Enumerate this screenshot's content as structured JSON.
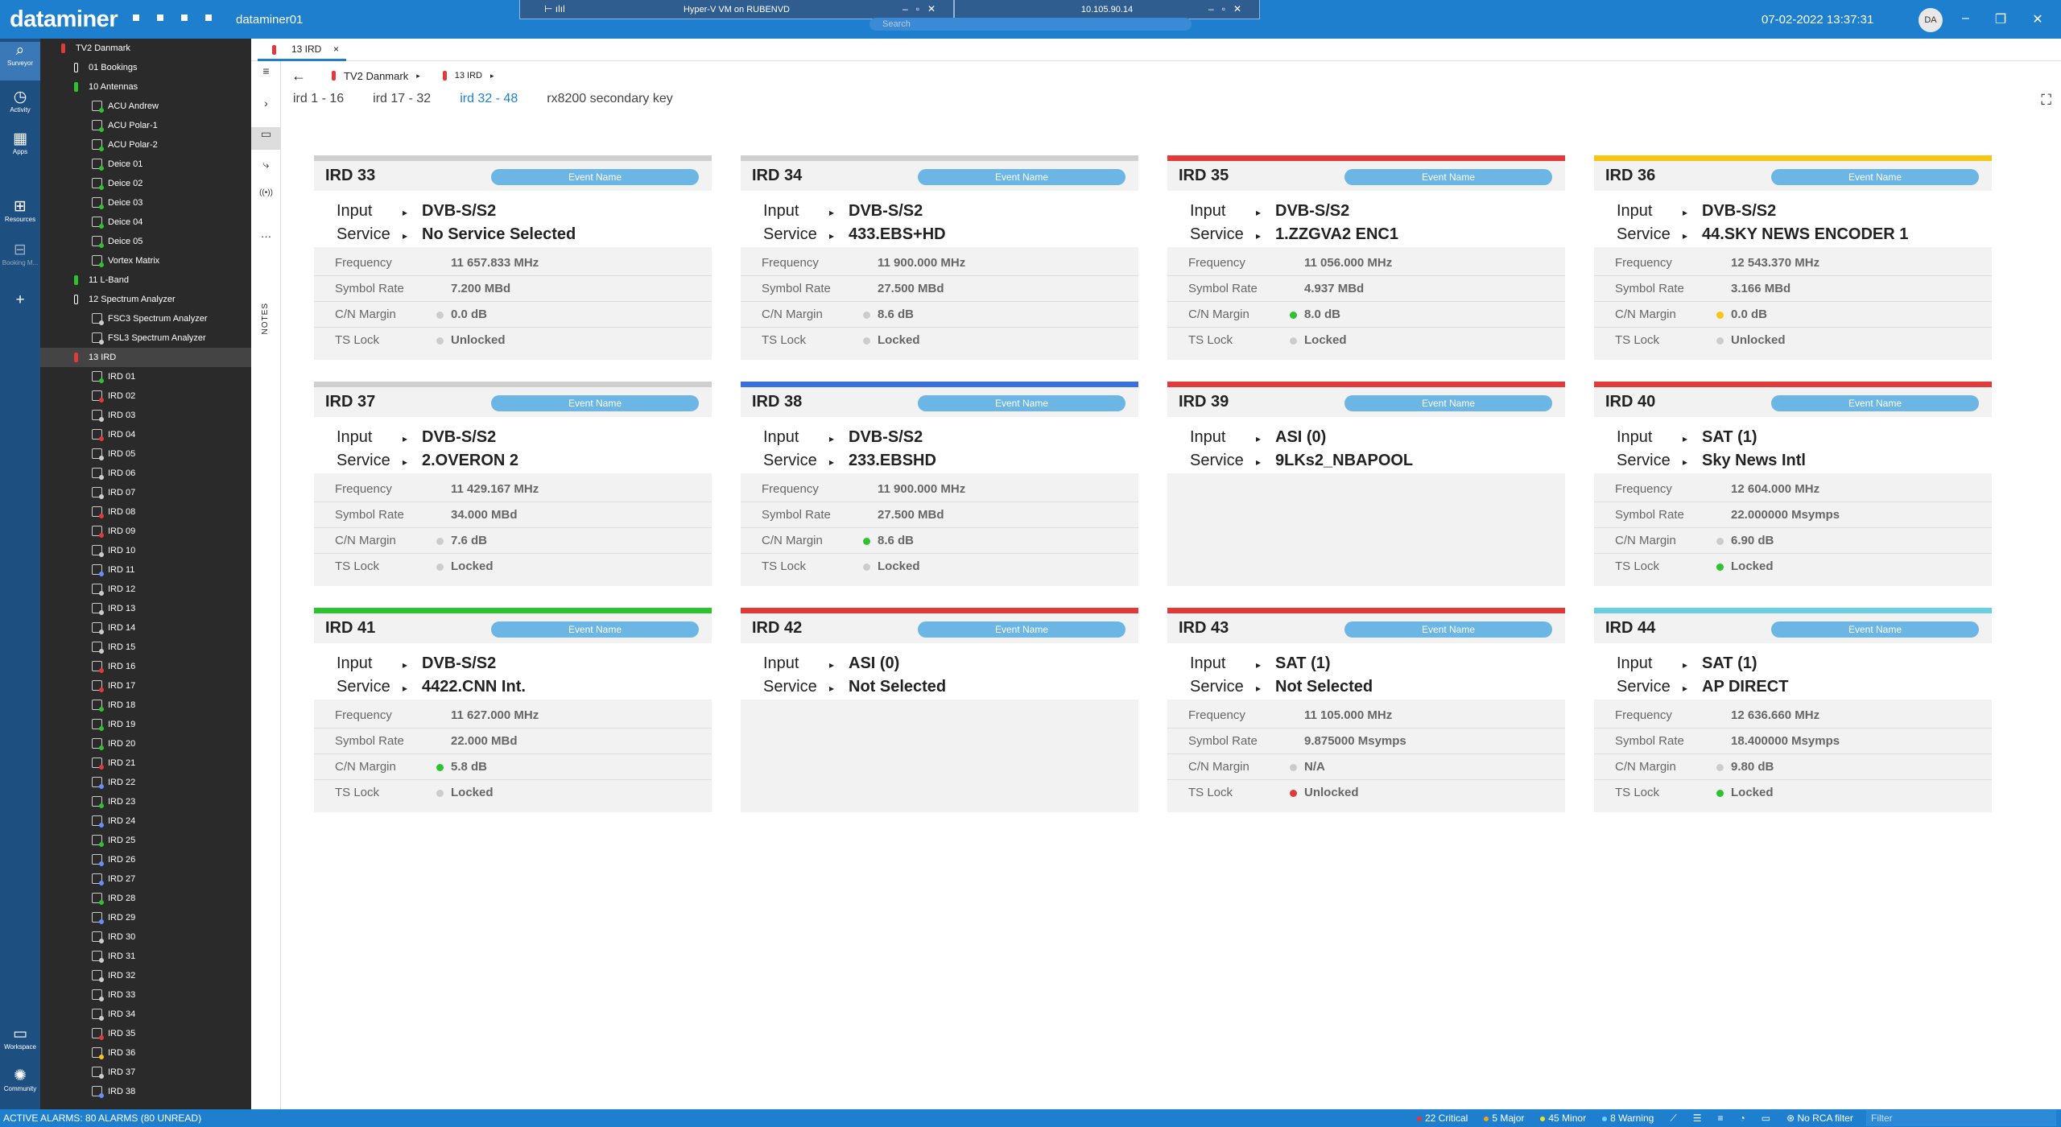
{
  "app": {
    "logo": "dataminer",
    "agent": "dataminer01",
    "datetime": "07-02-2022 13:37:31",
    "user_initials": "DA",
    "search_placeholder": "Search"
  },
  "rdp": {
    "host_label": "Hyper-V VM on RUBENVD",
    "ip": "10.105.90.14"
  },
  "rail": [
    {
      "label": "Surveyor",
      "icon": "surveyor-icon"
    },
    {
      "label": "Activity",
      "icon": "clock-icon"
    },
    {
      "label": "Apps",
      "icon": "grid-icon"
    },
    {
      "label": "Resources",
      "icon": "resources-icon"
    },
    {
      "label": "Booking M...",
      "icon": "booking-icon"
    },
    {
      "label": "Workspace",
      "icon": "workspace-icon"
    },
    {
      "label": "Community",
      "icon": "community-icon"
    }
  ],
  "tree": [
    {
      "label": "TV2 Danmark",
      "type": "view",
      "color": "#e03a3a",
      "level": 0
    },
    {
      "label": "01 Bookings",
      "type": "view",
      "color": "#ffffff",
      "level": 1
    },
    {
      "label": "10 Antennas",
      "type": "view",
      "color": "#2ec22e",
      "level": 1
    },
    {
      "label": "ACU Andrew",
      "type": "el",
      "color": "#2ec22e",
      "level": 2
    },
    {
      "label": "ACU Polar-1",
      "type": "el",
      "color": "#2ec22e",
      "level": 2
    },
    {
      "label": "ACU Polar-2",
      "type": "el",
      "color": "#2ec22e",
      "level": 2
    },
    {
      "label": "Deice 01",
      "type": "el",
      "color": "#2ec22e",
      "level": 2
    },
    {
      "label": "Deice 02",
      "type": "el",
      "color": "#2ec22e",
      "level": 2
    },
    {
      "label": "Deice 03",
      "type": "el",
      "color": "#2ec22e",
      "level": 2
    },
    {
      "label": "Deice 04",
      "type": "el",
      "color": "#2ec22e",
      "level": 2
    },
    {
      "label": "Deice 05",
      "type": "el",
      "color": "#2ec22e",
      "level": 2
    },
    {
      "label": "Vortex Matrix",
      "type": "el",
      "color": "#2ec22e",
      "level": 2
    },
    {
      "label": "11 L-Band",
      "type": "view",
      "color": "#2ec22e",
      "level": 1
    },
    {
      "label": "12 Spectrum Analyzer",
      "type": "view",
      "color": "#ffffff",
      "level": 1
    },
    {
      "label": "FSC3 Spectrum Analyzer",
      "type": "el",
      "color": "#cccccc",
      "level": 2
    },
    {
      "label": "FSL3 Spectrum Analyzer",
      "type": "el",
      "color": "#cccccc",
      "level": 2
    },
    {
      "label": "13 IRD",
      "type": "view",
      "color": "#e03a3a",
      "level": 1,
      "selected": true
    },
    {
      "label": "IRD 01",
      "type": "el",
      "color": "#2ec22e",
      "level": 2
    },
    {
      "label": "IRD 02",
      "type": "el",
      "color": "#e03a3a",
      "level": 2
    },
    {
      "label": "IRD 03",
      "type": "el",
      "color": "#cccccc",
      "level": 2
    },
    {
      "label": "IRD 04",
      "type": "el",
      "color": "#e03a3a",
      "level": 2
    },
    {
      "label": "IRD 05",
      "type": "el",
      "color": "#cccccc",
      "level": 2
    },
    {
      "label": "IRD 06",
      "type": "el",
      "color": "#cccccc",
      "level": 2
    },
    {
      "label": "IRD 07",
      "type": "el",
      "color": "#cccccc",
      "level": 2
    },
    {
      "label": "IRD 08",
      "type": "el",
      "color": "#e03a3a",
      "level": 2
    },
    {
      "label": "IRD 09",
      "type": "el",
      "color": "#e03a3a",
      "level": 2
    },
    {
      "label": "IRD 10",
      "type": "el",
      "color": "#cccccc",
      "level": 2
    },
    {
      "label": "IRD 11",
      "type": "el",
      "color": "#6b8cff",
      "level": 2
    },
    {
      "label": "IRD 12",
      "type": "el",
      "color": "#cccccc",
      "level": 2
    },
    {
      "label": "IRD 13",
      "type": "el",
      "color": "#cccccc",
      "level": 2
    },
    {
      "label": "IRD 14",
      "type": "el",
      "color": "#cccccc",
      "level": 2
    },
    {
      "label": "IRD 15",
      "type": "el",
      "color": "#cccccc",
      "level": 2
    },
    {
      "label": "IRD 16",
      "type": "el",
      "color": "#e03a3a",
      "level": 2
    },
    {
      "label": "IRD 17",
      "type": "el",
      "color": "#e03a3a",
      "level": 2
    },
    {
      "label": "IRD 18",
      "type": "el",
      "color": "#2ec22e",
      "level": 2
    },
    {
      "label": "IRD 19",
      "type": "el",
      "color": "#2ec22e",
      "level": 2
    },
    {
      "label": "IRD 20",
      "type": "el",
      "color": "#2ec22e",
      "level": 2
    },
    {
      "label": "IRD 21",
      "type": "el",
      "color": "#e03a3a",
      "level": 2
    },
    {
      "label": "IRD 22",
      "type": "el",
      "color": "#6b8cff",
      "level": 2
    },
    {
      "label": "IRD 23",
      "type": "el",
      "color": "#2ec22e",
      "level": 2
    },
    {
      "label": "IRD 24",
      "type": "el",
      "color": "#6b8cff",
      "level": 2
    },
    {
      "label": "IRD 25",
      "type": "el",
      "color": "#2ec22e",
      "level": 2
    },
    {
      "label": "IRD 26",
      "type": "el",
      "color": "#6b8cff",
      "level": 2
    },
    {
      "label": "IRD 27",
      "type": "el",
      "color": "#6b8cff",
      "level": 2
    },
    {
      "label": "IRD 28",
      "type": "el",
      "color": "#2ec22e",
      "level": 2
    },
    {
      "label": "IRD 29",
      "type": "el",
      "color": "#6b8cff",
      "level": 2
    },
    {
      "label": "IRD 30",
      "type": "el",
      "color": "#cccccc",
      "level": 2
    },
    {
      "label": "IRD 31",
      "type": "el",
      "color": "#cccccc",
      "level": 2
    },
    {
      "label": "IRD 32",
      "type": "el",
      "color": "#cccccc",
      "level": 2
    },
    {
      "label": "IRD 33",
      "type": "el",
      "color": "#cccccc",
      "level": 2
    },
    {
      "label": "IRD 34",
      "type": "el",
      "color": "#cccccc",
      "level": 2
    },
    {
      "label": "IRD 35",
      "type": "el",
      "color": "#e03a3a",
      "level": 2
    },
    {
      "label": "IRD 36",
      "type": "el",
      "color": "#f5c518",
      "level": 2
    },
    {
      "label": "IRD 37",
      "type": "el",
      "color": "#cccccc",
      "level": 2
    },
    {
      "label": "IRD 38",
      "type": "el",
      "color": "#6b8cff",
      "level": 2
    }
  ],
  "tab": {
    "label": "13 IRD",
    "close": "×"
  },
  "breadcrumb": [
    "TV2 Danmark",
    "13 IRD"
  ],
  "page_tabs": [
    {
      "label": "ird 1 - 16"
    },
    {
      "label": "ird 17 - 32"
    },
    {
      "label": "ird 32 - 48",
      "active": true
    },
    {
      "label": "rx8200 secondary key"
    }
  ],
  "sidetools_notes": "NOTES",
  "stat_keys": [
    "Frequency",
    "Symbol Rate",
    "C/N Margin",
    "TS Lock"
  ],
  "row_keys": [
    "Input",
    "Service"
  ],
  "event_label": "Event Name",
  "cards": [
    {
      "name": "IRD 33",
      "bar": "#cfcfcf",
      "input": "DVB-S/S2",
      "service": "No Service Selected",
      "freq": "11 657.833 MHz",
      "symbol": "7.200 MBd",
      "cn": "0.0 dB",
      "cn_dot": "#cccccc",
      "lock": "Unlocked",
      "lock_dot": "#cccccc"
    },
    {
      "name": "IRD 34",
      "bar": "#cfcfcf",
      "input": "DVB-S/S2",
      "service": "433.EBS+HD",
      "freq": "11 900.000 MHz",
      "symbol": "27.500 MBd",
      "cn": "8.6 dB",
      "cn_dot": "#cccccc",
      "lock": "Locked",
      "lock_dot": "#cccccc"
    },
    {
      "name": "IRD 35",
      "bar": "#e03a3a",
      "input": "DVB-S/S2",
      "service": "1.ZZGVA2 ENC1",
      "freq": "11 056.000 MHz",
      "symbol": "4.937 MBd",
      "cn": "8.0 dB",
      "cn_dot": "#2ec22e",
      "lock": "Locked",
      "lock_dot": "#cccccc"
    },
    {
      "name": "IRD 36",
      "bar": "#f5c518",
      "input": "DVB-S/S2",
      "service": "44.SKY NEWS ENCODER 1",
      "freq": "12 543.370 MHz",
      "symbol": "3.166 MBd",
      "cn": "0.0 dB",
      "cn_dot": "#f5c518",
      "lock": "Unlocked",
      "lock_dot": "#cccccc"
    },
    {
      "name": "IRD 37",
      "bar": "#cfcfcf",
      "input": "DVB-S/S2",
      "service": "2.OVERON 2",
      "freq": "11 429.167 MHz",
      "symbol": "34.000 MBd",
      "cn": "7.6 dB",
      "cn_dot": "#cccccc",
      "lock": "Locked",
      "lock_dot": "#cccccc"
    },
    {
      "name": "IRD 38",
      "bar": "#3a6fe0",
      "input": "DVB-S/S2",
      "service": "233.EBSHD",
      "freq": "11 900.000 MHz",
      "symbol": "27.500 MBd",
      "cn": "8.6 dB",
      "cn_dot": "#2ec22e",
      "lock": "Locked",
      "lock_dot": "#cccccc"
    },
    {
      "name": "IRD 39",
      "bar": "#e03a3a",
      "input": "ASI (0)",
      "service": "9LKs2_NBAPOOL"
    },
    {
      "name": "IRD 40",
      "bar": "#e03a3a",
      "input": "SAT (1)",
      "service": "Sky News Intl",
      "freq": "12 604.000 MHz",
      "symbol": "22.000000 Msymps",
      "cn": "6.90 dB",
      "cn_dot": "#cccccc",
      "lock": "Locked",
      "lock_dot": "#2ec22e"
    },
    {
      "name": "IRD 41",
      "bar": "#2ec22e",
      "input": "DVB-S/S2",
      "service": "4422.CNN Int.",
      "freq": "11 627.000 MHz",
      "symbol": "22.000 MBd",
      "cn": "5.8 dB",
      "cn_dot": "#2ec22e",
      "lock": "Locked",
      "lock_dot": "#cccccc"
    },
    {
      "name": "IRD 42",
      "bar": "#e03a3a",
      "input": "ASI (0)",
      "service": "Not Selected"
    },
    {
      "name": "IRD 43",
      "bar": "#e03a3a",
      "input": "SAT (1)",
      "service": "Not Selected",
      "freq": "11 105.000 MHz",
      "symbol": "9.875000 Msymps",
      "cn": "N/A",
      "cn_dot": "#cccccc",
      "lock": "Unlocked",
      "lock_dot": "#e03a3a"
    },
    {
      "name": "IRD 44",
      "bar": "#6ad0e0",
      "input": "SAT (1)",
      "service": "AP DIRECT",
      "freq": "12 636.660 MHz",
      "symbol": "18.400000 Msymps",
      "cn": "9.80 dB",
      "cn_dot": "#cccccc",
      "lock": "Locked",
      "lock_dot": "#2ec22e"
    }
  ],
  "status": {
    "alarms": "ACTIVE ALARMS: 80 ALARMS (80 UNREAD)",
    "critical": "22 Critical",
    "major": "5 Major",
    "minor": "45 Minor",
    "warning": "8 Warning",
    "rca": "No RCA filter",
    "filter_placeholder": "Filter"
  }
}
